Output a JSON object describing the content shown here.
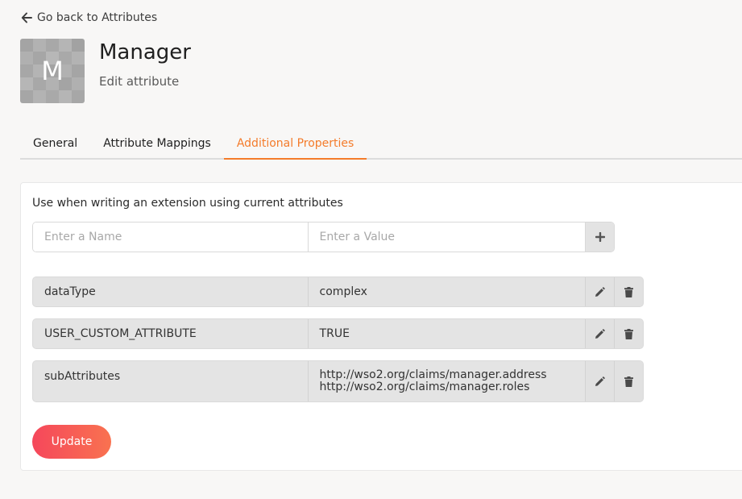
{
  "header": {
    "back_label": "Go back to Attributes",
    "avatar_letter": "M",
    "title": "Manager",
    "subtitle": "Edit attribute"
  },
  "tabs": [
    {
      "label": "General",
      "active": false
    },
    {
      "label": "Attribute Mappings",
      "active": false
    },
    {
      "label": "Additional Properties",
      "active": true
    }
  ],
  "panel": {
    "description": "Use when writing an extension using current attributes",
    "name_placeholder": "Enter a Name",
    "value_placeholder": "Enter a Value",
    "properties": [
      {
        "name": "dataType",
        "values": [
          "complex"
        ]
      },
      {
        "name": "USER_CUSTOM_ATTRIBUTE",
        "values": [
          "TRUE"
        ]
      },
      {
        "name": "subAttributes",
        "values": [
          "http://wso2.org/claims/manager.address",
          "http://wso2.org/claims/manager.roles"
        ]
      }
    ],
    "update_label": "Update"
  },
  "colors": {
    "accent": "#f47b2a",
    "button_gradient_start": "#f5475b",
    "button_gradient_end": "#f97250"
  },
  "icons": {
    "back": "arrow-left-icon",
    "add": "plus-icon",
    "edit": "pencil-icon",
    "delete": "trash-icon"
  }
}
